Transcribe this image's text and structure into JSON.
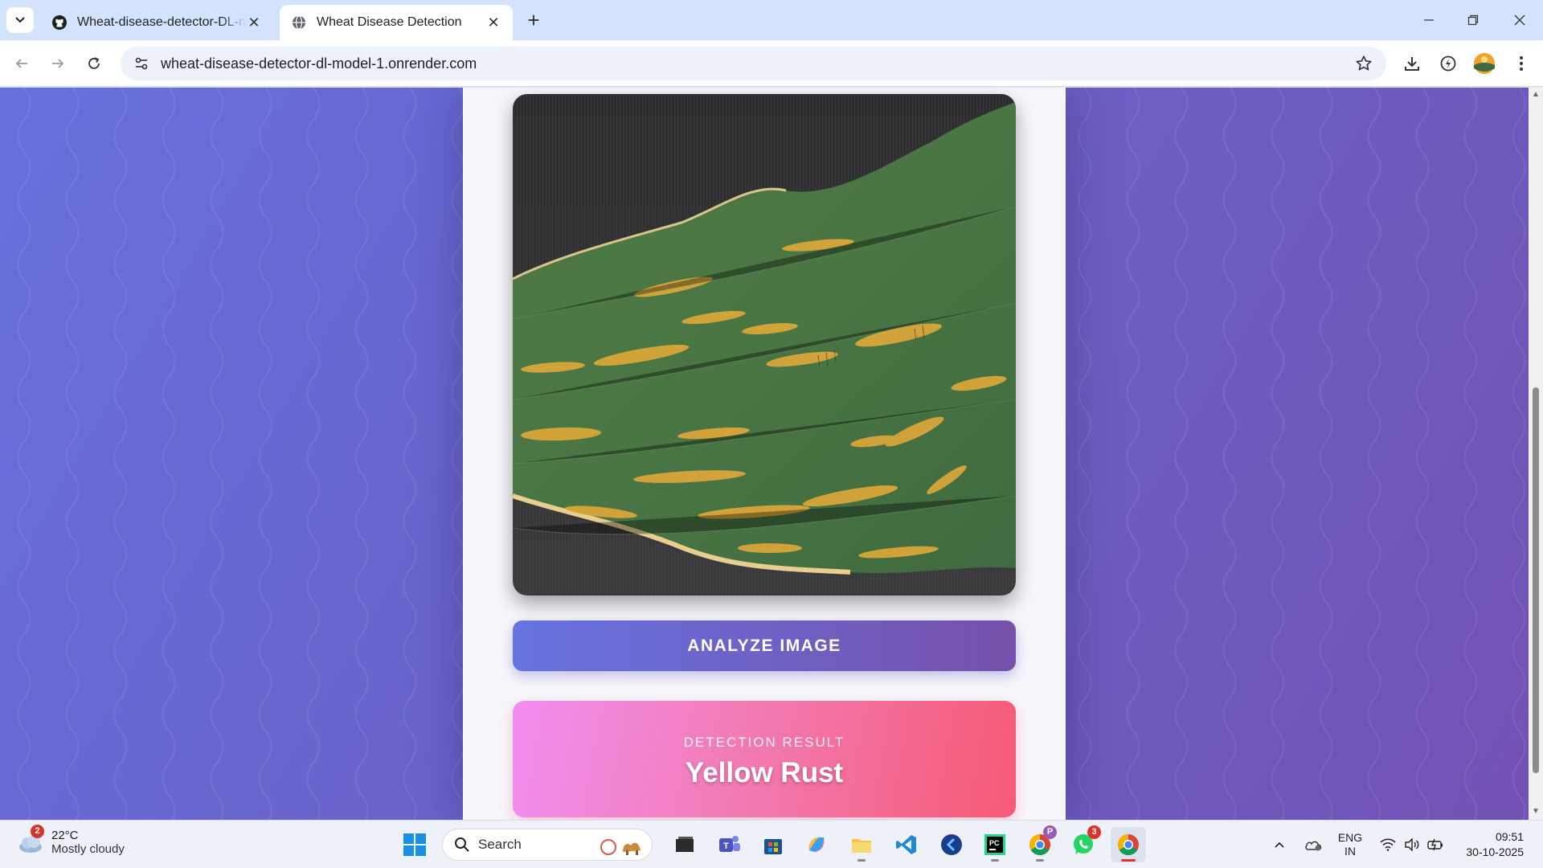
{
  "browser": {
    "tabs": [
      {
        "title": "Wheat-disease-detector-DL-model",
        "favicon": "github-icon",
        "active": false
      },
      {
        "title": "Wheat Disease Detection",
        "favicon": "globe-icon",
        "active": true
      }
    ],
    "url": "wheat-disease-detector-dl-model-1.onrender.com"
  },
  "page": {
    "image_alt": "Uploaded wheat leaf with yellow rust stripes",
    "analyze_label": "ANALYZE IMAGE",
    "result": {
      "label": "DETECTION RESULT",
      "value": "Yellow Rust"
    },
    "colors": {
      "background_start": "#6670dd",
      "background_end": "#7252b4",
      "button_start": "#6673e0",
      "button_end": "#7650aa",
      "result_start": "#f08ef0",
      "result_end": "#f55a74"
    }
  },
  "taskbar": {
    "weather": {
      "temp": "22°C",
      "condition": "Mostly cloudy",
      "badge": "2"
    },
    "search_label": "Search",
    "apps": [
      "start-icon",
      "task-view-icon",
      "teams-icon",
      "store-icon",
      "copilot-icon",
      "file-explorer-icon",
      "vscode-icon",
      "clipchamp-icon",
      "pycharm-icon",
      "chrome-profile-icon",
      "whatsapp-icon",
      "chrome-icon"
    ],
    "whatsapp_badge": "3",
    "profile_badge": "P",
    "language": {
      "line1": "ENG",
      "line2": "IN"
    },
    "time": "09:51",
    "date": "30-10-2025"
  }
}
